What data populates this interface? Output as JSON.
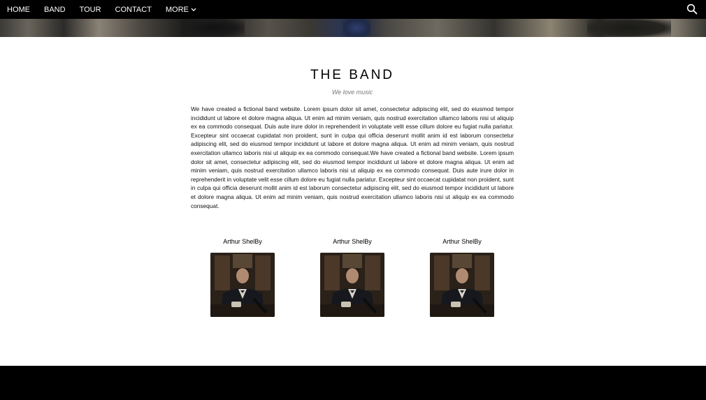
{
  "nav": {
    "items": [
      {
        "label": "HOME"
      },
      {
        "label": "BAND"
      },
      {
        "label": "TOUR"
      },
      {
        "label": "CONTACT"
      },
      {
        "label": "MORE"
      }
    ],
    "more_icon": "chevron-down-icon",
    "search_icon": "search-icon"
  },
  "band": {
    "title": "THE BAND",
    "subtitle": "We love music",
    "description": "We have created a fictional band website. Lorem ipsum dolor sit amet, consectetur adipiscing elit, sed do eiusmod tempor incididunt ut labore et dolore magna aliqua. Ut enim ad minim veniam, quis nostrud exercitation ullamco laboris nisi ut aliquip ex ea commodo consequat. Duis aute irure dolor in reprehenderit in voluptate velit esse cillum dolore eu fugiat nulla pariatur. Excepteur sint occaecat cupidatat non proident, sunt in culpa qui officia deserunt mollit anim id est laborum consectetur adipiscing elit, sed do eiusmod tempor incididunt ut labore et dolore magna aliqua. Ut enim ad minim veniam, quis nostrud exercitation ullamco laboris nisi ut aliquip ex ea commodo consequat.We have created a fictional band website. Lorem ipsum dolor sit amet, consectetur adipiscing elit, sed do eiusmod tempor incididunt ut labore et dolore magna aliqua. Ut enim ad minim veniam, quis nostrud exercitation ullamco laboris nisi ut aliquip ex ea commodo consequat. Duis aute irure dolor in reprehenderit in voluptate velit esse cillum dolore eu fugiat nulla pariatur. Excepteur sint occaecat cupidatat non proident, sunt in culpa qui officia deserunt mollit anim id est laborum consectetur adipiscing elit, sed do eiusmod tempor incididunt ut labore et dolore magna aliqua. Ut enim ad minim veniam, quis nostrud exercitation ullamco laboris nisi ut aliquip ex ea commodo consequat."
  },
  "members": [
    {
      "name": "Arthur ShelBy"
    },
    {
      "name": "Arthur ShelBy"
    },
    {
      "name": "Arthur ShelBy"
    }
  ]
}
